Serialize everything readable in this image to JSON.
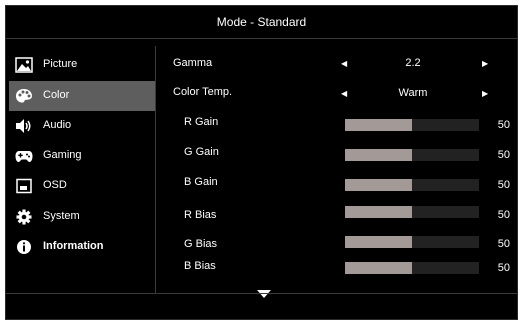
{
  "header": {
    "title": "Mode - Standard"
  },
  "sidebar": {
    "items": [
      {
        "label": "Picture",
        "icon": "picture-icon"
      },
      {
        "label": "Color",
        "icon": "palette-icon"
      },
      {
        "label": "Audio",
        "icon": "speaker-icon"
      },
      {
        "label": "Gaming",
        "icon": "gamepad-icon"
      },
      {
        "label": "OSD",
        "icon": "osd-window-icon"
      },
      {
        "label": "System",
        "icon": "gear-icon"
      },
      {
        "label": "Information",
        "icon": "info-icon"
      }
    ],
    "active": "Color"
  },
  "settings": {
    "gamma": {
      "label": "Gamma",
      "value": "2.2"
    },
    "color_temp": {
      "label": "Color Temp.",
      "value": "Warm"
    },
    "sliders": [
      {
        "label": "R Gain",
        "value": 50
      },
      {
        "label": "G Gain",
        "value": 50
      },
      {
        "label": "B Gain",
        "value": 50
      },
      {
        "label": "R Bias",
        "value": 50
      },
      {
        "label": "G Bias",
        "value": 50
      },
      {
        "label": "B Bias",
        "value": 50
      }
    ]
  },
  "colors": {
    "background": "#000000",
    "active_item": "#5e5e5e",
    "slider_fill": "#a39a98",
    "slider_track": "#222222"
  },
  "footer": {
    "more_indicator_icon": "chevron-down-icon"
  }
}
